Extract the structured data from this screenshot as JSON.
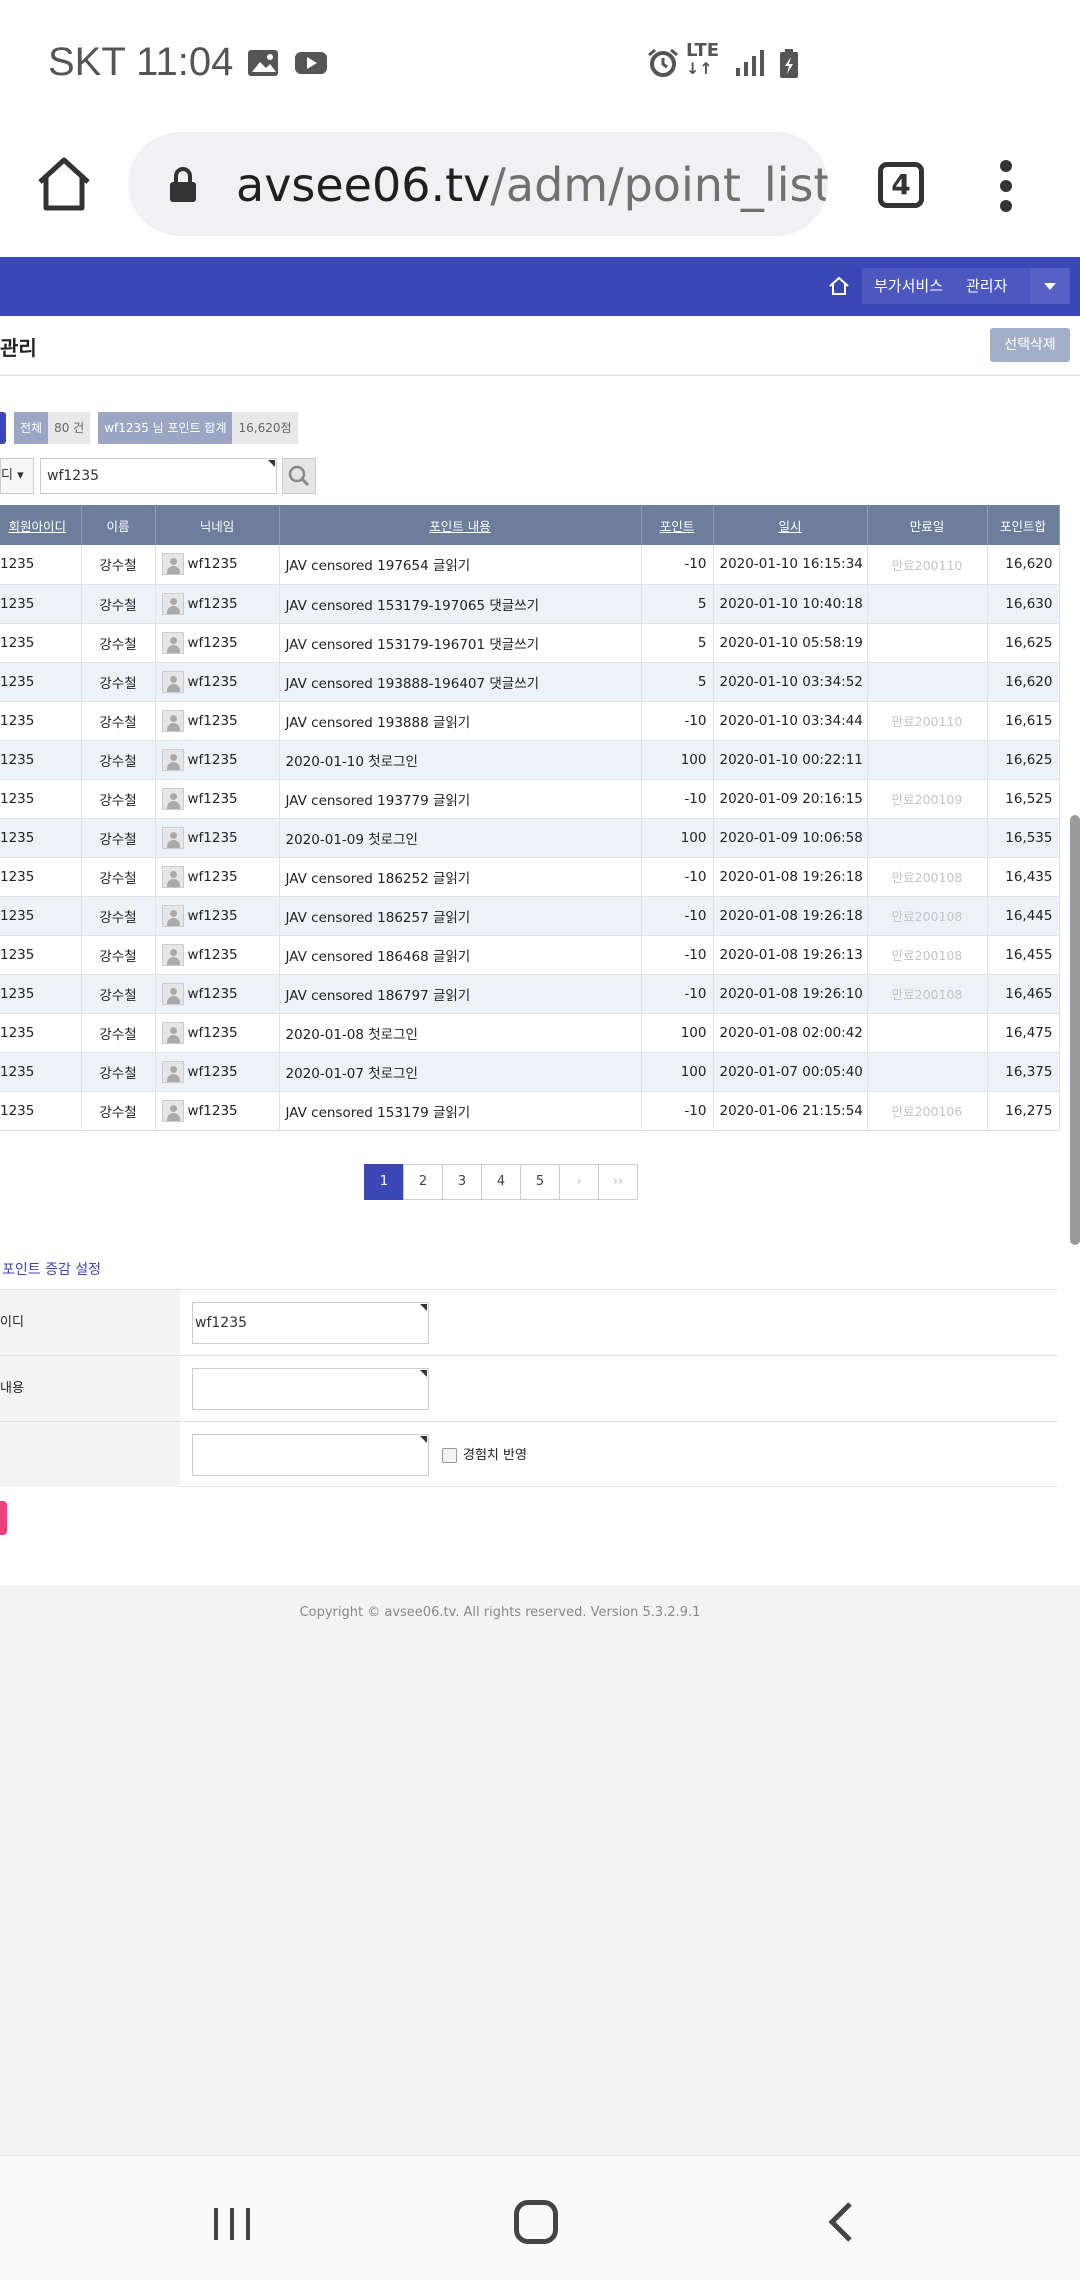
{
  "status_bar": {
    "carrier_time": "SKT 11:04",
    "network": "LTE"
  },
  "browser": {
    "url_domain": "avsee06.tv",
    "url_path": "/adm/point_list.p",
    "tab_count": "4"
  },
  "admin_header": {
    "buttons": [
      "부가서비스",
      "관리자"
    ]
  },
  "page": {
    "title": "관리",
    "delete_button": "선택삭제"
  },
  "summary": {
    "total_label": "전체",
    "total_value": "80 건",
    "sum_label": "wf1235 님 포인트 합계",
    "sum_value": "16,620점"
  },
  "search": {
    "field_select": "디",
    "query": "wf1235"
  },
  "table": {
    "headers": [
      "회원아이디",
      "이름",
      "닉네임",
      "포인트 내용",
      "포인트",
      "일시",
      "만료일",
      "포인트합"
    ],
    "rows": [
      {
        "id": "1235",
        "name": "강수철",
        "nick": "wf1235",
        "content": "JAV censored 197654 글읽기",
        "point": "-10",
        "datetime": "2020-01-10 16:15:34",
        "expire": "만료200110",
        "total": "16,620"
      },
      {
        "id": "1235",
        "name": "강수철",
        "nick": "wf1235",
        "content": "JAV censored 153179-197065 댓글쓰기",
        "point": "5",
        "datetime": "2020-01-10 10:40:18",
        "expire": "",
        "total": "16,630"
      },
      {
        "id": "1235",
        "name": "강수철",
        "nick": "wf1235",
        "content": "JAV censored 153179-196701 댓글쓰기",
        "point": "5",
        "datetime": "2020-01-10 05:58:19",
        "expire": "",
        "total": "16,625"
      },
      {
        "id": "1235",
        "name": "강수철",
        "nick": "wf1235",
        "content": "JAV censored 193888-196407 댓글쓰기",
        "point": "5",
        "datetime": "2020-01-10 03:34:52",
        "expire": "",
        "total": "16,620"
      },
      {
        "id": "1235",
        "name": "강수철",
        "nick": "wf1235",
        "content": "JAV censored 193888 글읽기",
        "point": "-10",
        "datetime": "2020-01-10 03:34:44",
        "expire": "만료200110",
        "total": "16,615"
      },
      {
        "id": "1235",
        "name": "강수철",
        "nick": "wf1235",
        "content": "2020-01-10 첫로그인",
        "point": "100",
        "datetime": "2020-01-10 00:22:11",
        "expire": "",
        "total": "16,625"
      },
      {
        "id": "1235",
        "name": "강수철",
        "nick": "wf1235",
        "content": "JAV censored 193779 글읽기",
        "point": "-10",
        "datetime": "2020-01-09 20:16:15",
        "expire": "만료200109",
        "total": "16,525"
      },
      {
        "id": "1235",
        "name": "강수철",
        "nick": "wf1235",
        "content": "2020-01-09 첫로그인",
        "point": "100",
        "datetime": "2020-01-09 10:06:58",
        "expire": "",
        "total": "16,535"
      },
      {
        "id": "1235",
        "name": "강수철",
        "nick": "wf1235",
        "content": "JAV censored 186252 글읽기",
        "point": "-10",
        "datetime": "2020-01-08 19:26:18",
        "expire": "만료200108",
        "total": "16,435"
      },
      {
        "id": "1235",
        "name": "강수철",
        "nick": "wf1235",
        "content": "JAV censored 186257 글읽기",
        "point": "-10",
        "datetime": "2020-01-08 19:26:18",
        "expire": "만료200108",
        "total": "16,445"
      },
      {
        "id": "1235",
        "name": "강수철",
        "nick": "wf1235",
        "content": "JAV censored 186468 글읽기",
        "point": "-10",
        "datetime": "2020-01-08 19:26:13",
        "expire": "만료200108",
        "total": "16,455"
      },
      {
        "id": "1235",
        "name": "강수철",
        "nick": "wf1235",
        "content": "JAV censored 186797 글읽기",
        "point": "-10",
        "datetime": "2020-01-08 19:26:10",
        "expire": "만료200108",
        "total": "16,465"
      },
      {
        "id": "1235",
        "name": "강수철",
        "nick": "wf1235",
        "content": "2020-01-08 첫로그인",
        "point": "100",
        "datetime": "2020-01-08 02:00:42",
        "expire": "",
        "total": "16,475"
      },
      {
        "id": "1235",
        "name": "강수철",
        "nick": "wf1235",
        "content": "2020-01-07 첫로그인",
        "point": "100",
        "datetime": "2020-01-07 00:05:40",
        "expire": "",
        "total": "16,375"
      },
      {
        "id": "1235",
        "name": "강수철",
        "nick": "wf1235",
        "content": "JAV censored 153179 글읽기",
        "point": "-10",
        "datetime": "2020-01-06 21:15:54",
        "expire": "만료200106",
        "total": "16,275"
      }
    ]
  },
  "pagination": {
    "pages": [
      "1",
      "2",
      "3",
      "4",
      "5"
    ],
    "current": "1",
    "next": "›",
    "last": "››"
  },
  "point_form": {
    "title": "포인트 증감 설정",
    "id_label": "이디",
    "id_value": "wf1235",
    "content_label": "내용",
    "content_value": "",
    "point_value": "",
    "exp_checkbox_label": "경험치 반영"
  },
  "footer": {
    "copyright": "Copyright © avsee06.tv. All rights reserved. Version 5.3.2.9.1"
  },
  "icons": {
    "gallery": "image-icon",
    "youtube": "youtube-icon",
    "alarm": "alarm-icon",
    "signal": "signal-icon",
    "battery": "battery-icon"
  },
  "colors": {
    "header_blue": "#3a47b5",
    "table_header": "#6d7d9c",
    "row_alt": "#edf1f8",
    "accent_pink": "#ec407a"
  }
}
